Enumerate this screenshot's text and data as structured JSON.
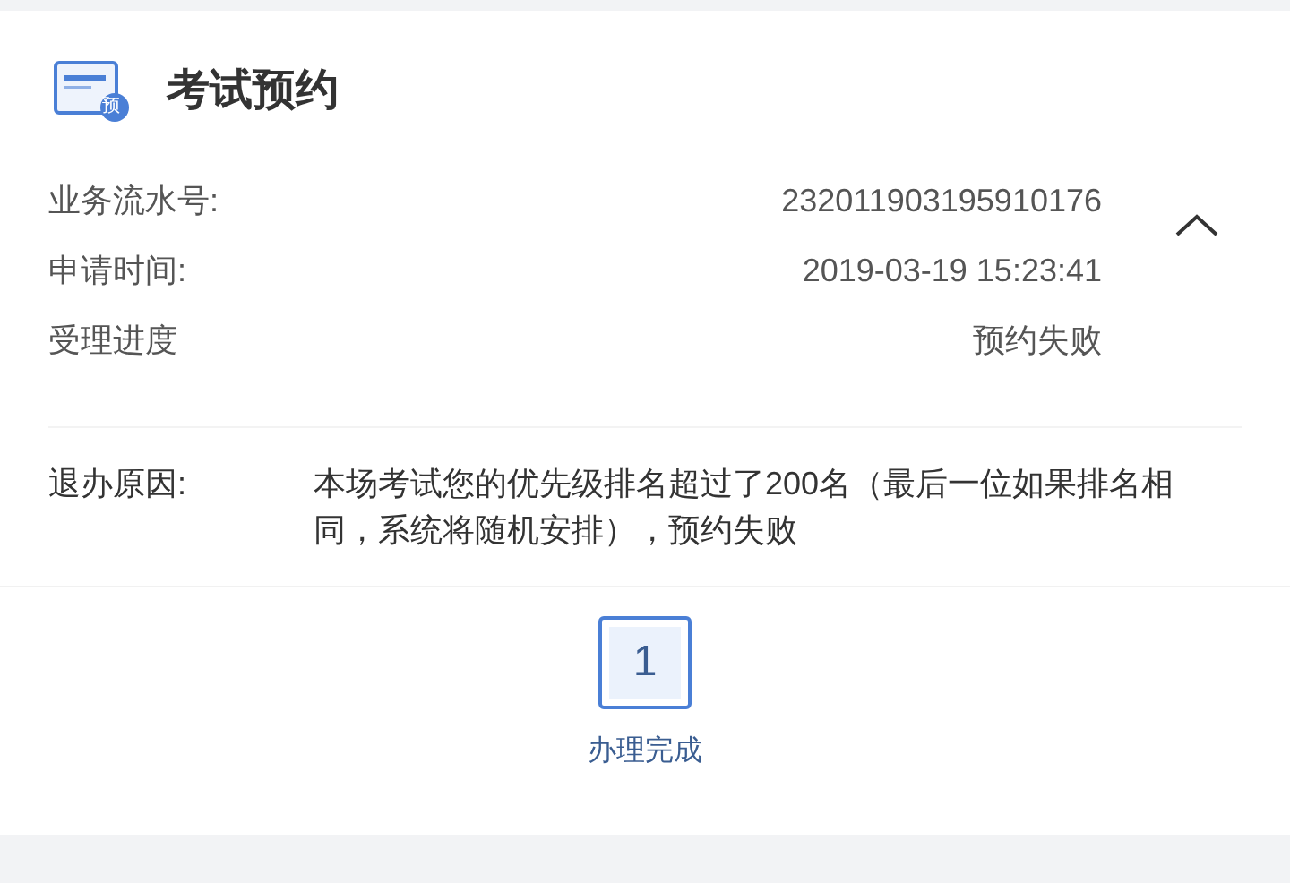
{
  "header": {
    "title": "考试预约",
    "icon_badge": "预"
  },
  "details": {
    "expanded": true,
    "rows": [
      {
        "label": "业务流水号:",
        "value": "232011903195910176"
      },
      {
        "label": "申请时间:",
        "value": "2019-03-19 15:23:41"
      },
      {
        "label": "受理进度",
        "value": "预约失败"
      }
    ]
  },
  "reason": {
    "label": "退办原因:",
    "text": "本场考试您的优先级排名超过了200名（最后一位如果排名相同，系统将随机安排），预约失败"
  },
  "steps": [
    {
      "number": "1",
      "label": "办理完成",
      "selected": true
    }
  ]
}
